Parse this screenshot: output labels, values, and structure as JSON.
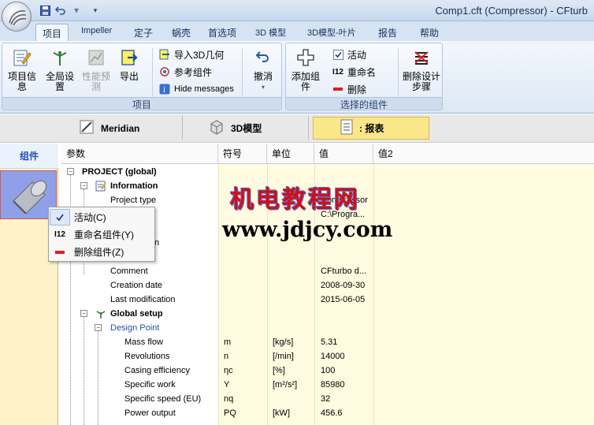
{
  "titlebar": {
    "title": "Comp1.cft (Compressor) - CFturb"
  },
  "tabs": [
    {
      "label": "项目"
    },
    {
      "label": "Impeller"
    },
    {
      "label": "定子"
    },
    {
      "label": "蜗壳"
    },
    {
      "label": "首选项"
    },
    {
      "label": "3D 模型"
    },
    {
      "label": "3D模型-叶片"
    },
    {
      "label": "报告"
    },
    {
      "label": "帮助"
    }
  ],
  "ribbon": {
    "group_project": {
      "label": "项目",
      "project_info": "项目信息",
      "global_settings": "全局设置",
      "performance_preview": "性能预测",
      "export": "导出",
      "import_3d": "导入3D几何",
      "reference_component": "参考组件",
      "hide_messages": "Hide messages",
      "undo": "撤消"
    },
    "group_components": {
      "label": "选择的组件",
      "add_component": "添加组件",
      "active": "活动",
      "rename": "重命名",
      "delete": "删除",
      "delete_design_steps": "删除设计步骤"
    }
  },
  "viewbar": {
    "meridian": "Meridian",
    "model3d": "3D模型",
    "report": ": 报表"
  },
  "leftpanel": {
    "header": "组件"
  },
  "grid": {
    "headers": {
      "param": "参数",
      "symbol": "符号",
      "unit": "单位",
      "value": "值",
      "value2": "值2"
    },
    "rows": [
      {
        "name": "PROJECT (global)",
        "sym": "",
        "unit": "",
        "val": ""
      },
      {
        "name": "Information",
        "sym": "",
        "unit": "",
        "val": ""
      },
      {
        "name": "Project type",
        "sym": "",
        "unit": "",
        "val": "Compressor"
      },
      {
        "name": "",
        "sym": "",
        "unit": "",
        "val": "C:\\Progra..."
      },
      {
        "name": "",
        "sym": "",
        "unit": "",
        "val": ""
      },
      {
        "name": "n",
        "sym": "",
        "unit": "",
        "val": ""
      },
      {
        "name": "",
        "sym": "",
        "unit": "",
        "val": ""
      },
      {
        "name": "Comment",
        "sym": "",
        "unit": "",
        "val": "CFturbo d..."
      },
      {
        "name": "Creation date",
        "sym": "",
        "unit": "",
        "val": "2008-09-30"
      },
      {
        "name": "Last modification",
        "sym": "",
        "unit": "",
        "val": "2015-06-05"
      },
      {
        "name": "Global setup",
        "sym": "",
        "unit": "",
        "val": ""
      },
      {
        "name": "Design Point",
        "sym": "",
        "unit": "",
        "val": ""
      },
      {
        "name": "Mass flow",
        "sym": "m",
        "unit": "[kg/s]",
        "val": "5.31"
      },
      {
        "name": "Revolutions",
        "sym": "n",
        "unit": "[/min]",
        "val": "14000"
      },
      {
        "name": "Casing efficiency",
        "sym": "ηc",
        "unit": "[%]",
        "val": "100"
      },
      {
        "name": "Specific work",
        "sym": "Y",
        "unit": "[m²/s²]",
        "val": "85980"
      },
      {
        "name": "Specific speed (EU)",
        "sym": "nq",
        "unit": "",
        "val": "32"
      },
      {
        "name": "Power output",
        "sym": "PQ",
        "unit": "[kW]",
        "val": "456.6"
      }
    ]
  },
  "context_menu": {
    "active": "活动(C)",
    "rename_component": "重命名组件(Y)",
    "delete_component": "删除组件(Z)"
  },
  "watermark": {
    "line1": "机电教程网",
    "line2": "www.jdjcy.com"
  }
}
